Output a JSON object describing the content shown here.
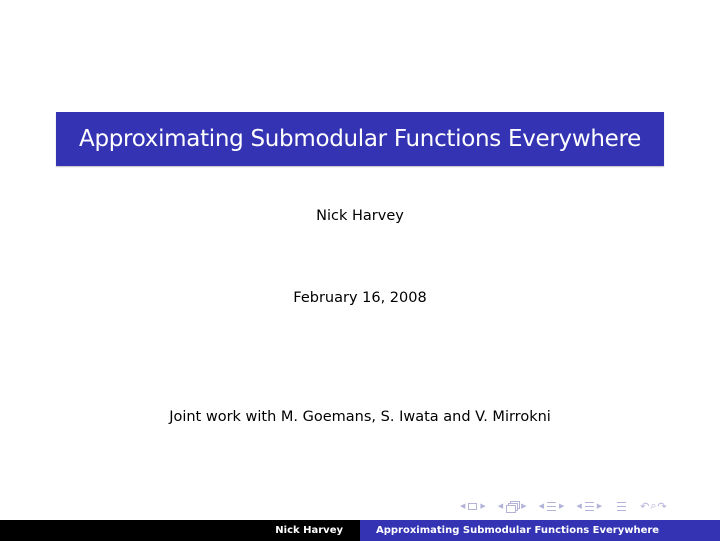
{
  "slide": {
    "title": "Approximating Submodular Functions Everywhere",
    "author": "Nick Harvey",
    "date": "February 16, 2008",
    "note": "Joint work with M. Goemans, S. Iwata and V. Mirrokni"
  },
  "navigation": {
    "icons": [
      "frame-prev",
      "frame",
      "frame-next",
      "subsection-prev",
      "subsection",
      "subsection-next",
      "section-prev",
      "section",
      "section-next",
      "subsection-alt-prev",
      "subsection-alt",
      "subsection-alt-next",
      "toc",
      "back",
      "search",
      "forward"
    ],
    "back_symbol": "↶",
    "search_symbol": "⌕",
    "forward_symbol": "↷",
    "left_arrow": "◀",
    "right_arrow": "▶"
  },
  "footer": {
    "author": "Nick Harvey",
    "title": "Approximating Submodular Functions Everywhere"
  },
  "colors": {
    "structure": "#3333b3",
    "footer_left": "#000000",
    "nav": "#b3b3d9"
  }
}
